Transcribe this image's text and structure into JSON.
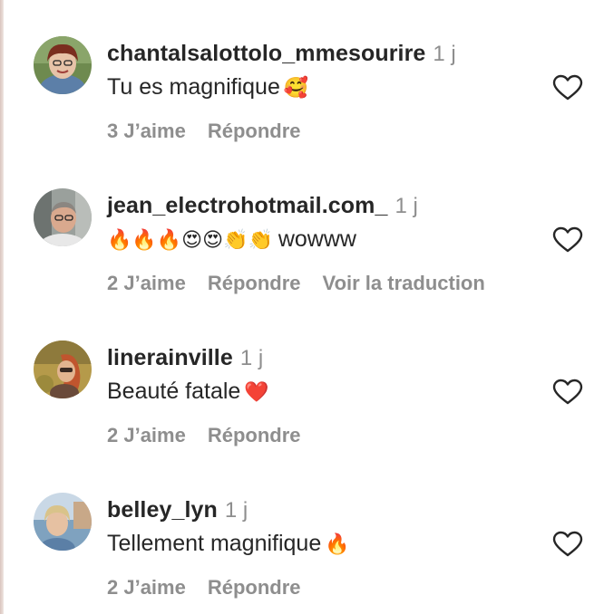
{
  "comments": [
    {
      "username": "chantalsalottolo_mmesourire",
      "time": "1 j",
      "text": "Tu es magnifique",
      "emoji": "🥰",
      "likes": "3 J’aime",
      "reply": "Répondre",
      "translate": ""
    },
    {
      "username": "jean_electrohotmail.com_",
      "time": "1 j",
      "text": "wowww",
      "emoji": "🔥🔥🔥😍😍👏👏",
      "likes": "2 J’aime",
      "reply": "Répondre",
      "translate": "Voir la traduction"
    },
    {
      "username": "linerainville",
      "time": "1 j",
      "text": "Beauté fatale",
      "emoji": "❤️",
      "likes": "2 J’aime",
      "reply": "Répondre",
      "translate": ""
    },
    {
      "username": "belley_lyn",
      "time": "1 j",
      "text": "Tellement magnifique",
      "emoji": "🔥",
      "likes": "2 J’aime",
      "reply": "Répondre",
      "translate": ""
    }
  ],
  "colors": {
    "text": "#262626",
    "muted": "#8e8e8e",
    "heart_stroke": "#262626"
  },
  "icons": {
    "like": "heart-outline-icon"
  }
}
